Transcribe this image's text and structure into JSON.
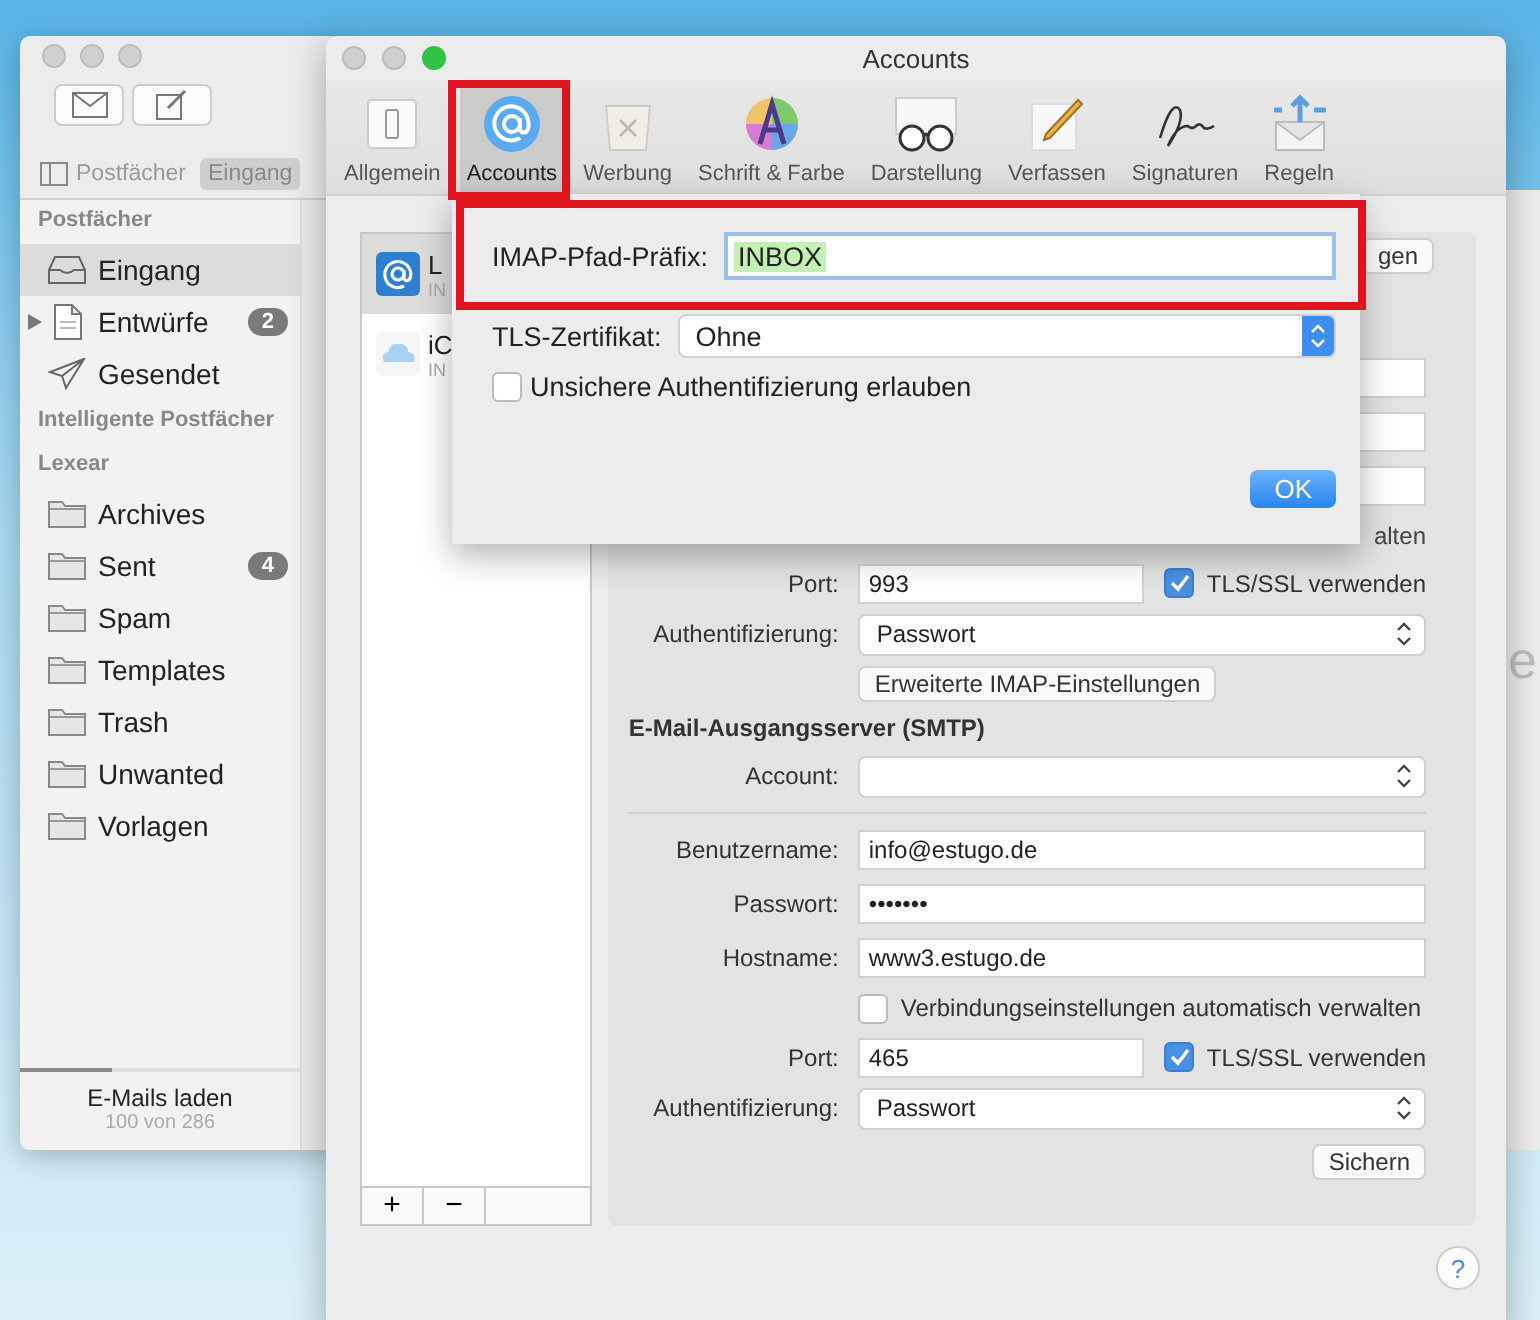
{
  "desktop_window": {
    "text": "e"
  },
  "mail_window": {
    "tabs": [
      {
        "label": "Postfächer",
        "selected": false
      },
      {
        "label": "Eingang",
        "selected": true
      }
    ],
    "sidebar": [
      {
        "title": "Postfächer",
        "items": [
          {
            "kind": "inbox",
            "label": "Eingang",
            "selected": true
          },
          {
            "kind": "drafts",
            "label": "Entwürfe",
            "selected": false,
            "expanded": false,
            "badge": "2"
          },
          {
            "kind": "sent",
            "label": "Gesendet",
            "selected": false
          }
        ]
      },
      {
        "title": "Intelligente Postfächer"
      },
      {
        "title": "Lexear",
        "items": [
          {
            "kind": "folder",
            "label": "Archives",
            "selected": false
          },
          {
            "kind": "folder",
            "label": "Sent",
            "selected": false,
            "badge": "4"
          },
          {
            "kind": "folder",
            "label": "Spam",
            "selected": false
          },
          {
            "kind": "folder",
            "label": "Templates",
            "selected": false
          },
          {
            "kind": "folder",
            "label": "Trash",
            "selected": false
          },
          {
            "kind": "folder",
            "label": "Unwanted",
            "selected": false
          },
          {
            "kind": "folder",
            "label": "Vorlagen",
            "selected": false
          }
        ]
      }
    ],
    "status": {
      "title": "E-Mails laden",
      "detail": "100 von 286",
      "level": 0.33
    }
  },
  "preferences": {
    "title": "Accounts",
    "tabs": [
      {
        "kind": "general",
        "label": "Allgemein",
        "selected": false
      },
      {
        "kind": "accounts",
        "label": "Accounts",
        "selected": true
      },
      {
        "kind": "junk",
        "label": "Werbung",
        "selected": false
      },
      {
        "kind": "fonts",
        "label": "Schrift & Farbe",
        "selected": false
      },
      {
        "kind": "viewing",
        "label": "Darstellung",
        "selected": false
      },
      {
        "kind": "composing",
        "label": "Verfassen",
        "selected": false
      },
      {
        "kind": "signatures",
        "label": "Signaturen",
        "selected": false
      },
      {
        "kind": "rules",
        "label": "Regeln",
        "selected": false
      }
    ],
    "accounts": [
      {
        "kind": "at",
        "name": "L",
        "subtitle": "IN",
        "selected": true
      },
      {
        "kind": "cloud",
        "name": "iC",
        "subtitle": "IN",
        "selected": false
      }
    ],
    "list_buttons": [
      "+",
      "−"
    ],
    "rows": [
      {
        "kind": "partial_button",
        "label": "gen"
      },
      {
        "kind": "stub"
      },
      {
        "kind": "stub"
      },
      {
        "kind": "stub"
      },
      {
        "kind": "partial_text",
        "text": "alten"
      },
      {
        "kind": "port",
        "label": "Port:",
        "value": "993",
        "option": "TLS/SSL verwenden",
        "checked": true
      },
      {
        "kind": "select",
        "label": "Authentifizierung:",
        "value": "Passwort"
      },
      {
        "kind": "button",
        "label": "Erweiterte IMAP-Einstellungen"
      },
      {
        "kind": "heading",
        "text": "E-Mail-Ausgangsserver (SMTP)"
      },
      {
        "kind": "select",
        "label": "Account:"
      },
      {
        "kind": "divider"
      },
      {
        "kind": "field",
        "label": "Benutzername:",
        "value": "info@estugo.de"
      },
      {
        "kind": "field",
        "label": "Passwort:",
        "value": "•••••••"
      },
      {
        "kind": "field",
        "label": "Hostname:",
        "value": "www3.estugo.de"
      },
      {
        "kind": "checkbox",
        "label": "Verbindungseinstellungen automatisch verwalten",
        "checked": false
      },
      {
        "kind": "port",
        "label": "Port:",
        "value": "465",
        "option": "TLS/SSL verwenden",
        "checked": true
      },
      {
        "kind": "select",
        "label": "Authentifizierung:",
        "value": "Passwort"
      },
      {
        "kind": "save",
        "label": "Sichern"
      }
    ],
    "help": "?"
  },
  "sheet": {
    "path_prefix": {
      "label": "IMAP-Pfad-Präfix:",
      "value": "INBOX"
    },
    "certificate": {
      "label": "TLS-Zertifikat:",
      "value": "Ohne"
    },
    "insecure_auth": {
      "label": "Unsichere Authentifizierung erlauben",
      "checked": false
    },
    "ok": "OK"
  }
}
